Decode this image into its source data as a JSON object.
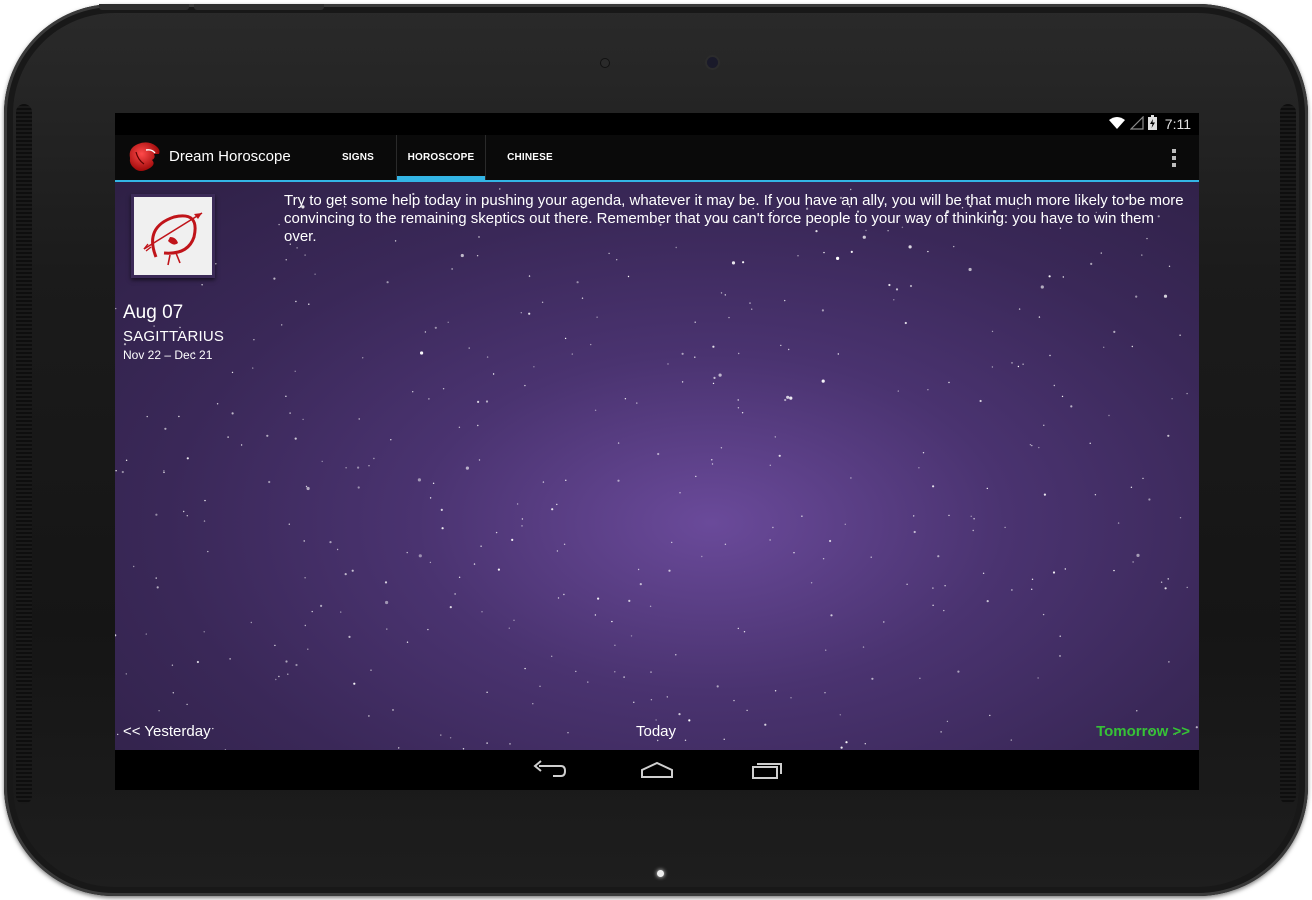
{
  "status_bar": {
    "time": "7:11",
    "icons": [
      "wifi-icon",
      "signal-icon",
      "battery-charging-icon"
    ]
  },
  "action_bar": {
    "app_title": "Dream Horoscope",
    "app_icon": "lion-logo-icon",
    "tabs": [
      {
        "label": "SIGNS",
        "selected": false
      },
      {
        "label": "HOROSCOPE",
        "selected": true
      },
      {
        "label": "CHINESE",
        "selected": false
      }
    ],
    "overflow_icon": "overflow-menu-icon",
    "accent_color": "#33b5e5"
  },
  "horoscope": {
    "sign_icon": "sagittarius-archer-icon",
    "date": "Aug 07",
    "sign_name": "SAGITTARIUS",
    "sign_range": "Nov 22 – Dec 21",
    "reading": "Try to get some help today in pushing your agenda, whatever it may be. If you have an ally, you will be that much more likely to be more convincing to the remaining skeptics out there. Remember that you can't force people to your way of thinking: you have to win them over."
  },
  "day_nav": {
    "yesterday": "<< Yesterday",
    "today": "Today",
    "tomorrow": "Tomorrow >>",
    "tomorrow_color": "#36c236"
  },
  "system_nav": {
    "icons": [
      "back-icon",
      "home-icon",
      "recent-apps-icon"
    ]
  }
}
